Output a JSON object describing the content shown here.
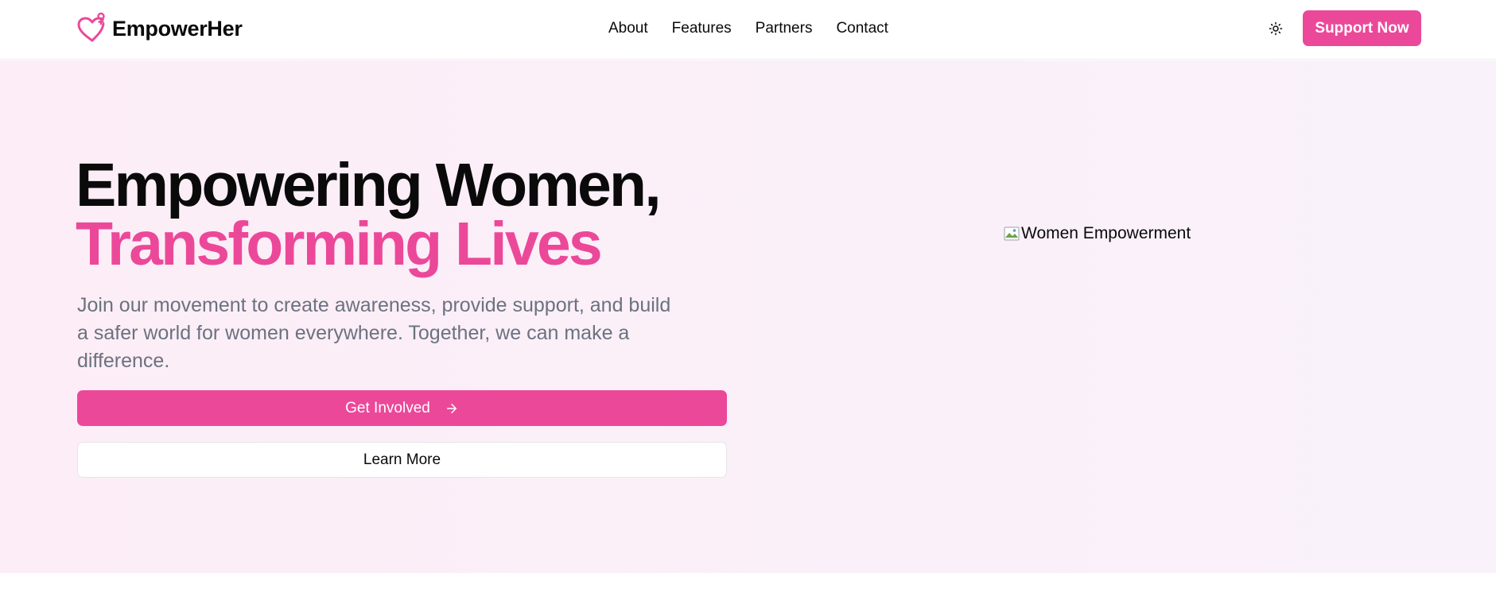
{
  "brand": {
    "name": "EmpowerHer",
    "logo_icon": "heart-venus-icon",
    "accent_color": "#ec4899"
  },
  "nav": {
    "items": [
      {
        "label": "About"
      },
      {
        "label": "Features"
      },
      {
        "label": "Partners"
      },
      {
        "label": "Contact"
      }
    ],
    "theme_toggle_icon": "sun-icon",
    "support_label": "Support Now"
  },
  "hero": {
    "title_line1": "Empowering Women,",
    "title_line2": "Transforming Lives",
    "subtitle": "Join our movement to create awareness, provide support, and build a safer world for women everywhere. Together, we can make a difference.",
    "primary_cta": "Get Involved",
    "primary_cta_icon": "arrow-right-icon",
    "secondary_cta": "Learn More",
    "image_alt": "Women Empowerment",
    "image_icon": "broken-image-icon"
  }
}
